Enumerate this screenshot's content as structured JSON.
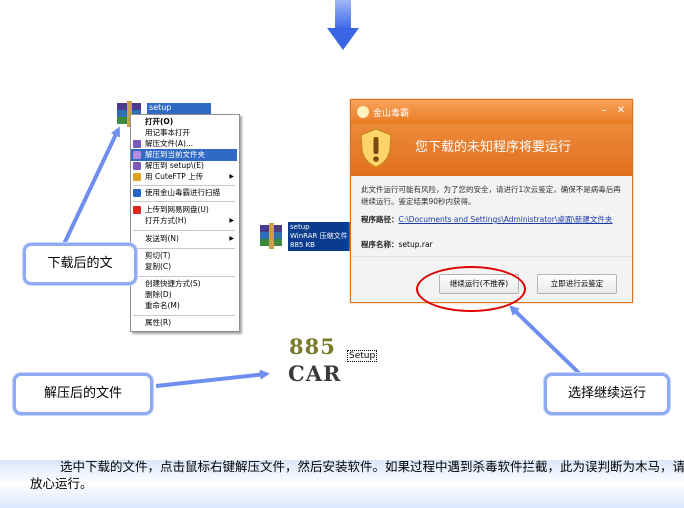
{
  "menu": {
    "file_label": "setup",
    "items": [
      {
        "label": "打开(O)",
        "bold": true
      },
      {
        "label": "用记事本打开"
      },
      {
        "label": "解压文件(A)..."
      },
      {
        "label": "解压到当前文件夹",
        "selected": true
      },
      {
        "label": "解压到 setup\\(E)"
      },
      {
        "label": "用 CuteFTP 上传",
        "submenu": true
      },
      {
        "label": "使用金山毒霸进行扫描"
      },
      {
        "label": "上传到网易网盘(U)"
      },
      {
        "label": "打开方式(H)",
        "submenu": true
      },
      {
        "label": "发送到(N)",
        "submenu": true
      },
      {
        "label": "剪切(T)"
      },
      {
        "label": "复制(C)"
      },
      {
        "label": "创建快捷方式(S)"
      },
      {
        "label": "删除(D)"
      },
      {
        "label": "重命名(M)"
      },
      {
        "label": "属性(R)"
      }
    ]
  },
  "rar_file": {
    "name": "setup",
    "type": "WinRAR 压缩文件",
    "size": "885 KB"
  },
  "dialog": {
    "title": "金山毒霸",
    "heading": "您下载的未知程序将要运行",
    "message": "此文件运行可能有风险，为了您的安全，请进行1次云鉴定，确保不是病毒后再继续运行。鉴定结果90秒内获得。",
    "path_label": "程序路径：",
    "path_value": "C:\\Documents and Settings\\Administrator\\桌面\\新建文件夹",
    "name_label": "程序名称：",
    "name_value": "setup.rar",
    "continue_button": "继续运行(不推荐)",
    "cloud_button": "立即进行云鉴定"
  },
  "extracted": {
    "logo_line1": "885",
    "logo_line2": "CAR",
    "label": "Setup"
  },
  "callouts": {
    "downloaded": "下载后的文",
    "extracted": "解压后的文件",
    "continue": "选择继续运行"
  },
  "instructions": "选中下载的文件，点击鼠标右键解压文件，然后安装软件。如果过程中遇到杀毒软件拦截，此为误判断为木马，请放心运行。",
  "colors": {
    "menu_highlight": "#316ac5",
    "dialog_orange": "#ea7a23",
    "callout_border": "#8eaaf3",
    "arrow_blue": "#6f8ff0",
    "ellipse_red": "#e00000"
  }
}
